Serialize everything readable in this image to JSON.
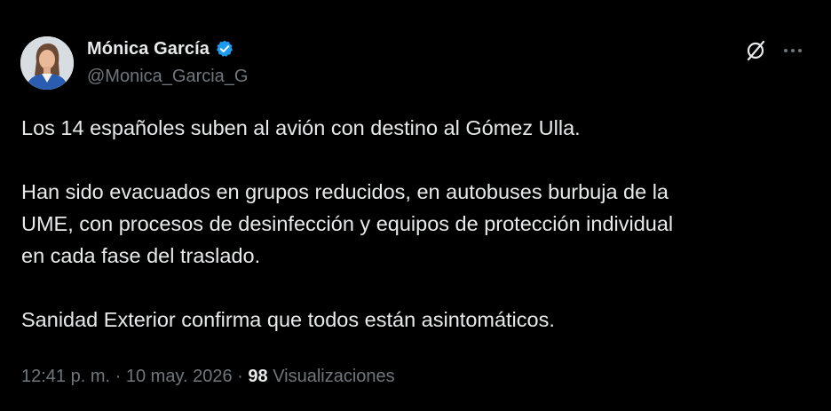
{
  "author": {
    "display_name": "Mónica García",
    "handle": "@Monica_Garcia_G",
    "verified_badge": "verified-badge-icon",
    "avatar": "avatar"
  },
  "actions": {
    "grok_icon": "grok-icon",
    "more_icon": "more-options-icon"
  },
  "tweet": {
    "paragraphs": [
      "Los 14 españoles suben al avión con destino al Gómez Ulla.",
      "Han sido evacuados en grupos reducidos, en autobuses burbuja de la UME, con procesos de desinfección y equipos de protección individual en cada fase del traslado.",
      "Sanidad Exterior confirma que todos están asintomáticos."
    ],
    "lines": [
      "Han sido evacuados en grupos reducidos, en autobuses burbuja de la",
      "UME, con procesos de desinfección y equipos de protección individual",
      "en cada fase del traslado."
    ]
  },
  "meta": {
    "time": "12:41 p. m.",
    "separator": "·",
    "date": "10 may. 2026",
    "views_count": "98",
    "views_label": "Visualizaciones"
  },
  "colors": {
    "background": "#000000",
    "text_primary": "#e7e9ea",
    "text_secondary": "#71767b",
    "verified": "#1d9bf0"
  }
}
